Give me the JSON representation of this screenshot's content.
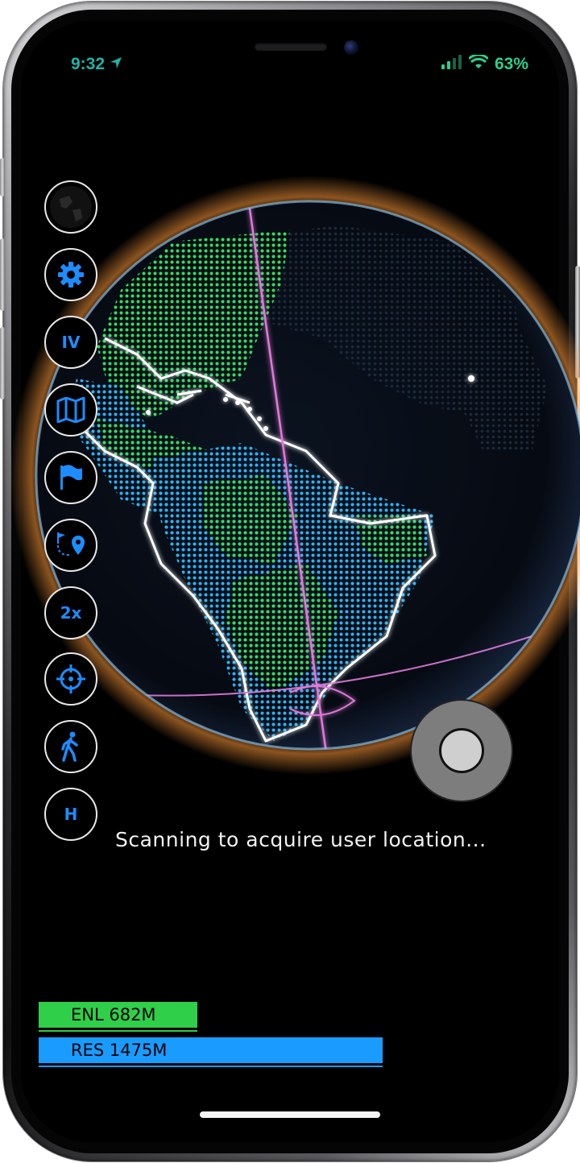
{
  "status_bar": {
    "time": "9:32",
    "battery": "63%",
    "icons": [
      "location-arrow-icon",
      "signal-icon",
      "wifi-icon"
    ]
  },
  "toolbar": {
    "buttons": [
      {
        "name": "globe-view-button",
        "icon": "globe-icon",
        "label": ""
      },
      {
        "name": "settings-button",
        "icon": "gear-icon",
        "label": ""
      },
      {
        "name": "iv-button",
        "icon": "",
        "label": "IV"
      },
      {
        "name": "map-button",
        "icon": "map-icon",
        "label": ""
      },
      {
        "name": "flag-button",
        "icon": "flag-icon",
        "label": ""
      },
      {
        "name": "route-button",
        "icon": "route-pin-icon",
        "label": ""
      },
      {
        "name": "zoom-2x-button",
        "icon": "",
        "label": "2x"
      },
      {
        "name": "target-button",
        "icon": "crosshair-icon",
        "label": ""
      },
      {
        "name": "walk-button",
        "icon": "walking-person-icon",
        "label": ""
      },
      {
        "name": "home-button",
        "icon": "",
        "label": "H"
      }
    ]
  },
  "scan": {
    "message": "Scanning to acquire user location..."
  },
  "scores": {
    "enl": {
      "label": "ENL 682M",
      "color": "#2fcf4a"
    },
    "res": {
      "label": "RES 1475M",
      "color": "#1a9bff"
    }
  },
  "colors": {
    "accent_blue": "#1e8cff",
    "status_teal": "#1fb3a6",
    "land_green": "#2fe05a",
    "land_cyan": "#27b6ff",
    "meridian_pink": "#e07ad8"
  }
}
